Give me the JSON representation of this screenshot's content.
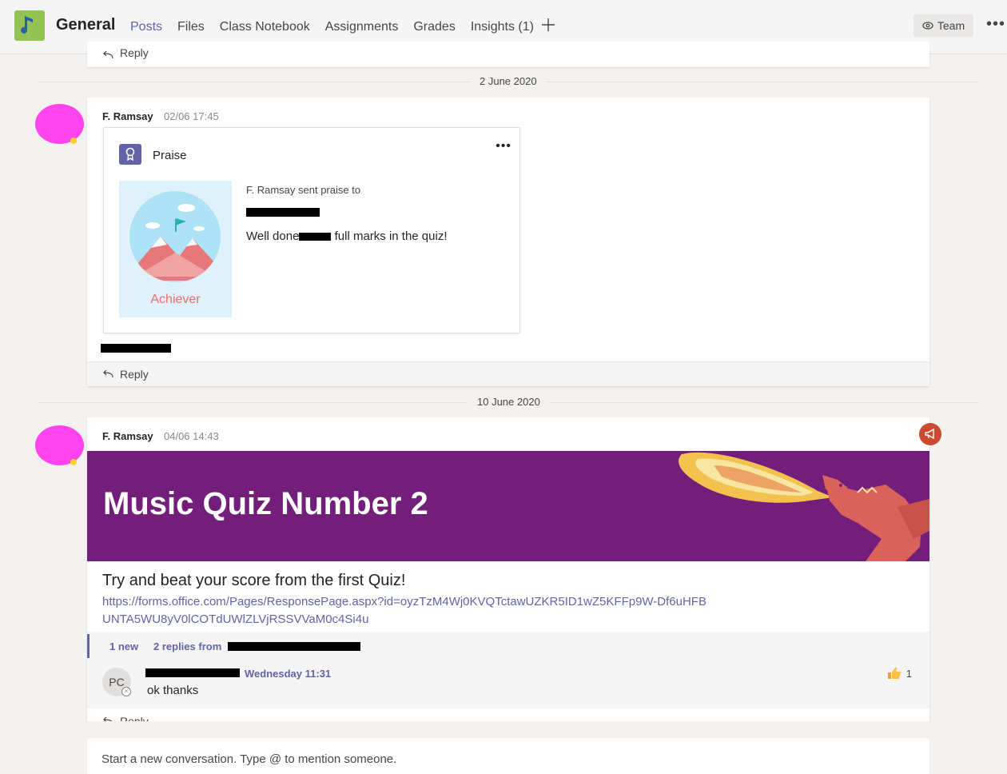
{
  "header": {
    "channel_title": "General",
    "tabs": [
      "Posts",
      "Files",
      "Class Notebook",
      "Assignments",
      "Grades",
      "Insights (1)"
    ],
    "team_button": "Team",
    "more": "•••"
  },
  "top_stub": {
    "reply_label": "Reply"
  },
  "dates": [
    "2 June 2020",
    "10 June 2020"
  ],
  "post1": {
    "author": "F. Ramsay",
    "time": "02/06 17:45",
    "praise": {
      "title": "Praise",
      "more": "•••",
      "badge": "Achiever",
      "sent_text": "F. Ramsay sent praise to",
      "message_start": "Well done",
      "message_end": " full marks in the quiz!"
    },
    "reply_label": "Reply"
  },
  "post2": {
    "author": "F. Ramsay",
    "time": "04/06 14:43",
    "banner_title": "Music Quiz Number 2",
    "heading": "Try and beat your score from the first Quiz!",
    "link": "https://forms.office.com/Pages/ResponsePage.aspx?id=oyzTzM4Wj0KVQTctawUZKR5ID1wZ5KFFp9W-Df6uHFBUNTA5WU8yV0lCOTdUWlZLVjRSSVVaM0c4Si4u",
    "new_count": "1 new",
    "replies_from": "2 replies from",
    "reply": {
      "avatar_initials": "PC",
      "time": "Wednesday 11:31",
      "text": "ok thanks",
      "likes": "1"
    },
    "reply_label": "Reply"
  },
  "compose": {
    "placeholder": "Start a new conversation. Type @ to mention someone."
  },
  "colors": {
    "accent": "#6264a7",
    "banner": "#721e7a",
    "avatar_pink": "#ff44ee",
    "badge_red": "#e86d6a"
  }
}
